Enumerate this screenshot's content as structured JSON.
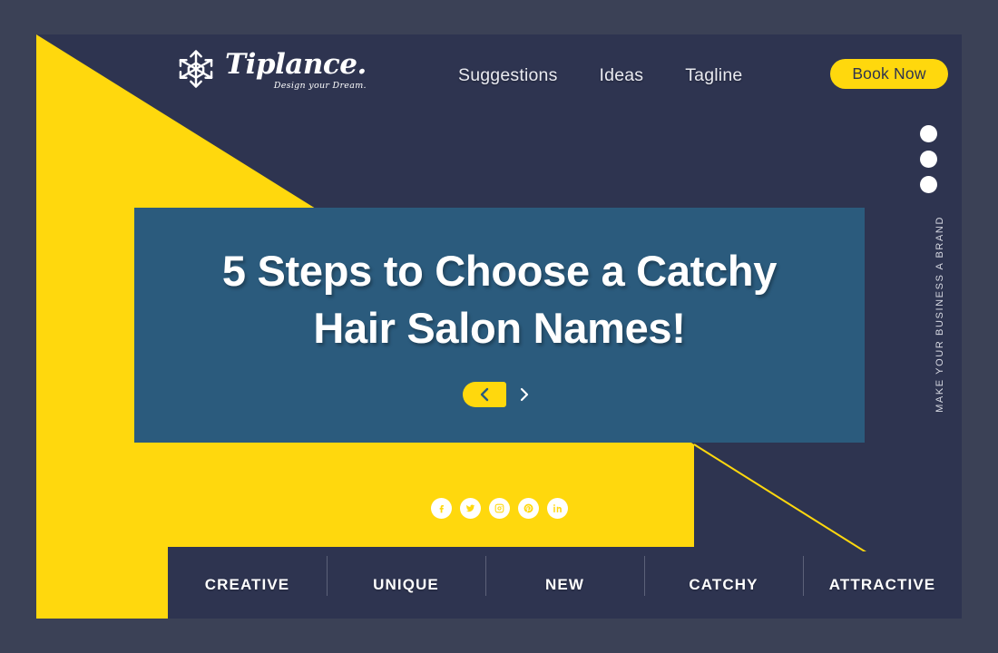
{
  "brand": {
    "name": "Tiplance.",
    "tagline": "Design your Dream.",
    "logo_icon": "snowflake-icon"
  },
  "nav": {
    "items": [
      {
        "label": "Suggestions"
      },
      {
        "label": "Ideas"
      },
      {
        "label": "Tagline"
      }
    ],
    "cta_label": "Book Now"
  },
  "rail": {
    "dots_count": 3,
    "vertical_text": "MAKE YOUR BUSINESS A BRAND"
  },
  "hero": {
    "title_line1": "5 Steps to Choose a Catchy",
    "title_line2": "Hair Salon Names!",
    "prev_icon": "chevron-left-icon",
    "next_icon": "chevron-right-icon"
  },
  "social": {
    "items": [
      {
        "name": "facebook-icon"
      },
      {
        "name": "twitter-icon"
      },
      {
        "name": "instagram-icon"
      },
      {
        "name": "pinterest-icon"
      },
      {
        "name": "linkedin-icon"
      }
    ]
  },
  "tabs": {
    "items": [
      {
        "label": "CREATIVE"
      },
      {
        "label": "UNIQUE"
      },
      {
        "label": "NEW"
      },
      {
        "label": "CATCHY"
      },
      {
        "label": "ATTRACTIVE"
      }
    ]
  },
  "colors": {
    "yellow": "#ffd80d",
    "navy_dark": "#2e3450",
    "navy_frame": "#3b4156",
    "teal": "#2b5b7d",
    "white": "#ffffff"
  }
}
